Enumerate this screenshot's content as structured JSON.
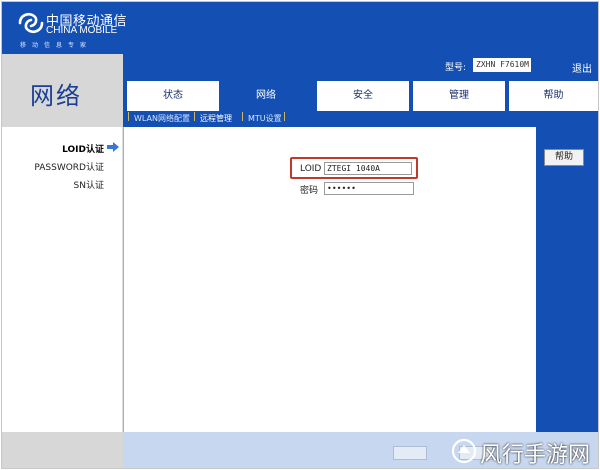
{
  "header": {
    "brand_cn": "中国移动通信",
    "brand_en": "CHINA MOBILE",
    "slogan": "移动信息专家",
    "model_label": "型号:",
    "model_value": "ZXHN F7610M",
    "logout_label": "退出"
  },
  "section_title": "网络",
  "tabs": [
    {
      "label": "状态",
      "active": false
    },
    {
      "label": "网络",
      "active": true
    },
    {
      "label": "安全",
      "active": false
    },
    {
      "label": "管理",
      "active": false
    },
    {
      "label": "帮助",
      "active": false
    }
  ],
  "subtabs": [
    {
      "label": "WLAN网络配置",
      "active": false
    },
    {
      "label": "远程管理",
      "active": true
    },
    {
      "label": "MTU设置",
      "active": false
    }
  ],
  "sidebar": {
    "items": [
      {
        "label": "LOID认证",
        "active": true
      },
      {
        "label": "PASSWORD认证",
        "active": false
      },
      {
        "label": "SN认证",
        "active": false
      }
    ]
  },
  "form": {
    "loid_label": "LOID",
    "loid_value": "ZTEGI  1040A",
    "password_label": "密码",
    "password_value": "••••••"
  },
  "help_button_label": "帮助",
  "watermark": "风行手游网",
  "colors": {
    "brand_blue": "#1450b4",
    "highlight_red": "#c0392b",
    "panel_gray": "#d7d7d7"
  }
}
